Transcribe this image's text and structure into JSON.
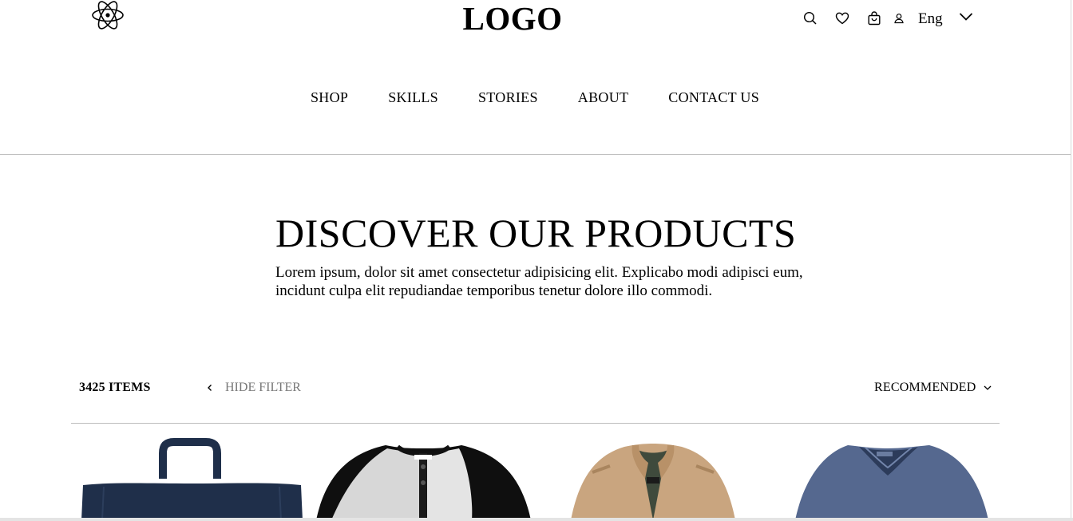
{
  "header": {
    "logo_text": "LOGO",
    "icons": [
      "atom-icon",
      "search-icon",
      "heart-icon",
      "shopping-bag-icon",
      "user-icon",
      "chevron-down-icon"
    ],
    "language": "Eng"
  },
  "nav": {
    "items": [
      "SHOP",
      "SKILLS",
      "STORIES",
      "ABOUT",
      "CONTACT US"
    ]
  },
  "hero": {
    "title": "DISCOVER OUR PRODUCTS",
    "description": "Lorem ipsum, dolor sit amet consectetur adipisicing elit. Explicabo modi adipisci eum, incidunt culpa elit repudiandae temporibus tenetur dolore illo commodi."
  },
  "toolbar": {
    "item_count": "3425 ITEMS",
    "hide_filter": "HIDE FILTER",
    "sort_label": "RECOMMENDED"
  },
  "products": [
    {
      "name": "navy-tote-bag",
      "color": "#1f2f4a"
    },
    {
      "name": "raglan-henley-tee",
      "color": "#111111"
    },
    {
      "name": "beige-jacket",
      "color": "#c9a57f"
    },
    {
      "name": "blue-vneck-tee",
      "color": "#55688f"
    }
  ]
}
